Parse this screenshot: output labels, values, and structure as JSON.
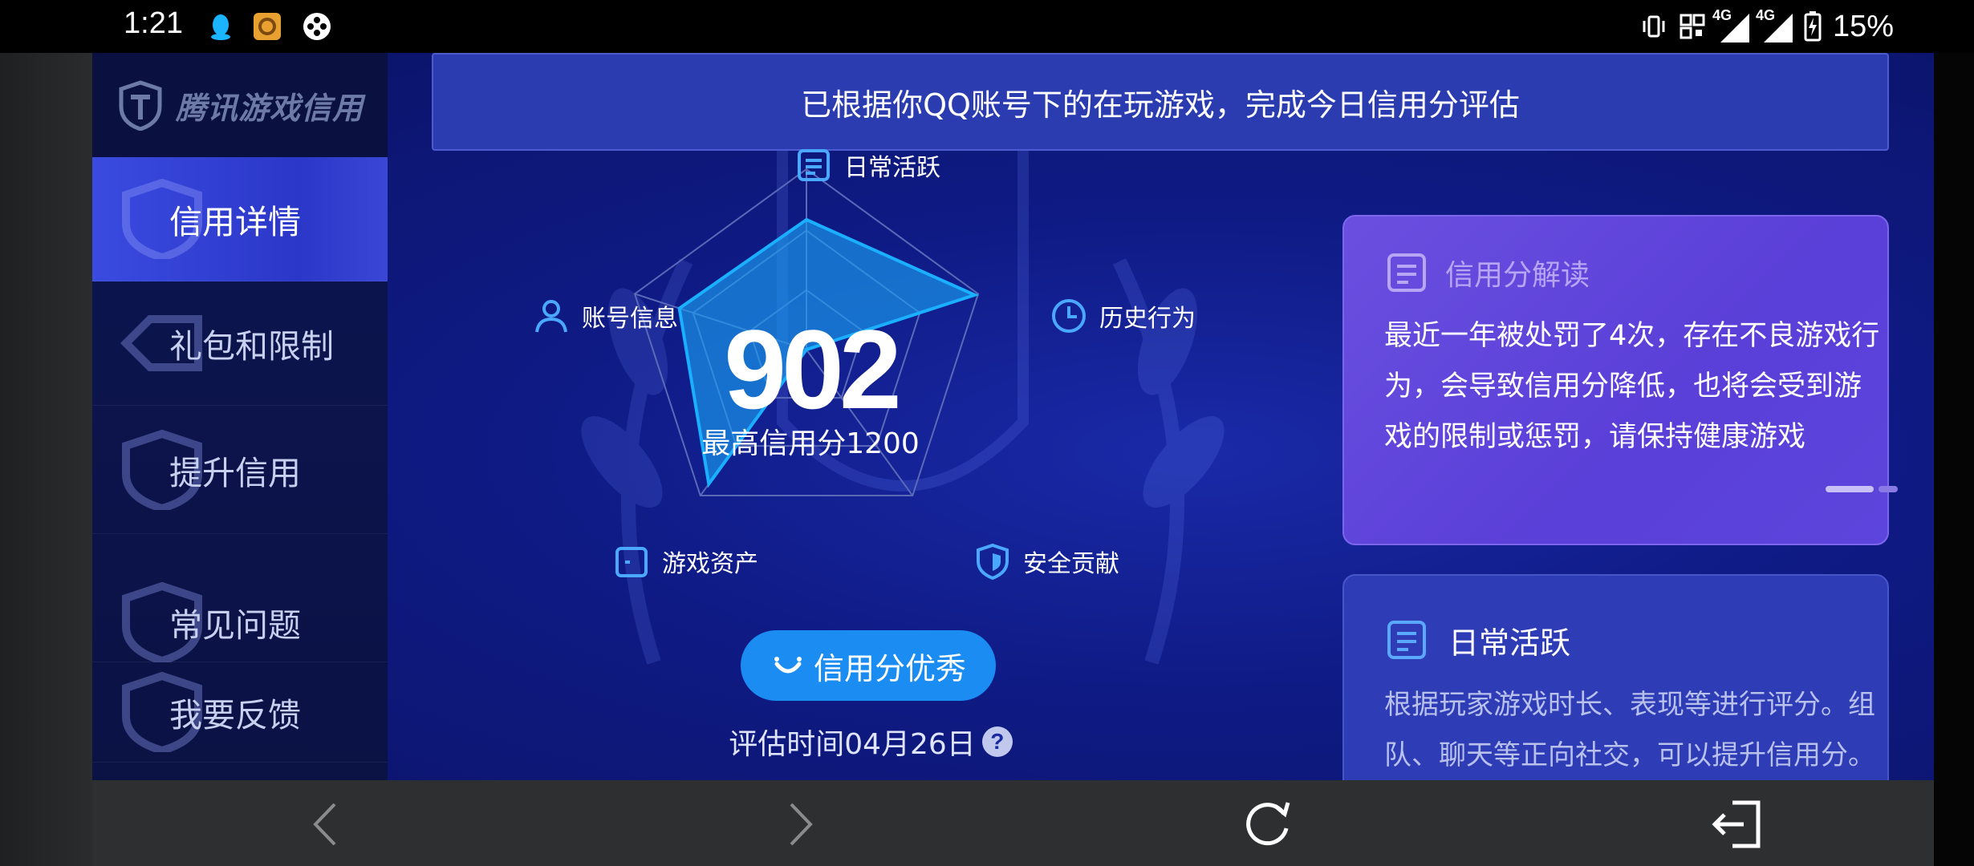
{
  "status_bar": {
    "time": "1:21",
    "left_icons": [
      "qq-icon",
      "app-icon",
      "game-controller-icon"
    ],
    "right_icons": [
      "vibrate-icon",
      "nfc-icon",
      "signal-4g-icon",
      "signal-4g-icon",
      "battery-charging-icon"
    ],
    "signal_label_1": "4G",
    "signal_label_2": "4G",
    "battery_percent": "15%"
  },
  "brand": {
    "name": "腾讯游戏信用"
  },
  "sidebar": {
    "items": [
      {
        "label": "信用详情",
        "active": true
      },
      {
        "label": "礼包和限制",
        "active": false
      },
      {
        "label": "提升信用",
        "active": false
      },
      {
        "label": "常见问题",
        "active": false
      },
      {
        "label": "我要反馈",
        "active": false
      }
    ]
  },
  "banner": {
    "text": "已根据你QQ账号下的在玩游戏，完成今日信用分评估"
  },
  "radar": {
    "dimensions": [
      {
        "label": "日常活跃",
        "icon": "document-icon",
        "level": 0.72
      },
      {
        "label": "历史行为",
        "icon": "clock-icon",
        "level": 0.98
      },
      {
        "label": "安全贡献",
        "icon": "shield-icon",
        "level": 0.0
      },
      {
        "label": "游戏资产",
        "icon": "wallet-icon",
        "level": 0.92
      },
      {
        "label": "账号信息",
        "icon": "user-icon",
        "level": 0.74
      }
    ],
    "score": "902",
    "max_score_label": "最高信用分1200",
    "colors": {
      "fill": "#1a9df0",
      "stroke": "#1ab0ff",
      "grid": "#5a6ab8"
    }
  },
  "rating": {
    "label": "信用分优秀",
    "icon": "smile-icon"
  },
  "eval": {
    "text": "评估时间04月26日",
    "help_icon": "?"
  },
  "card_interp": {
    "title": "信用分解读",
    "body": "最近一年被处罚了4次，存在不良游戏行为，会导致信用分降低，也将会受到游戏的限制或惩罚，请保持健康游戏"
  },
  "card_daily": {
    "title": "日常活跃",
    "body": "根据玩家游戏时长、表现等进行评分。组队、聊天等正向社交，可以提升信用分。恶"
  },
  "bottom_nav": {
    "icons": [
      "back-arrow-icon",
      "forward-arrow-icon",
      "refresh-icon",
      "exit-icon"
    ]
  }
}
